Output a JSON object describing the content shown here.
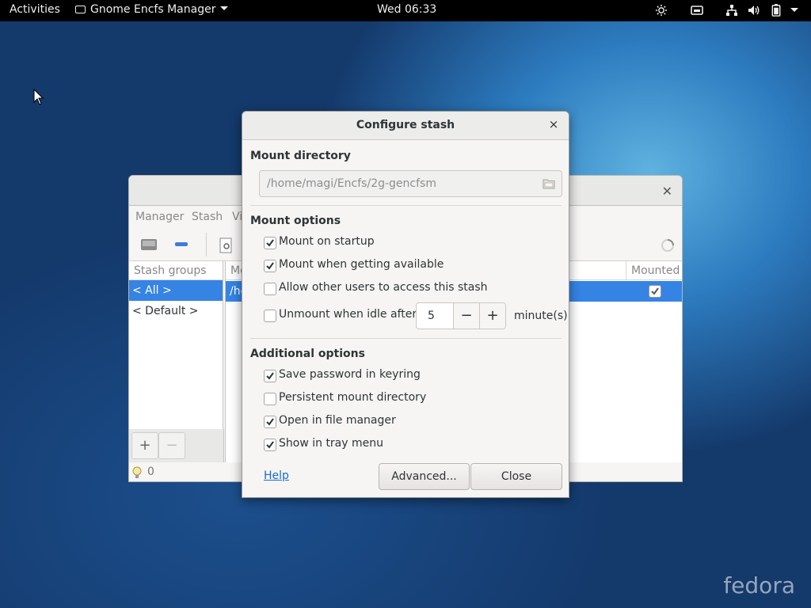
{
  "topbar": {
    "activities": "Activities",
    "app_name": "Gnome Encfs Manager",
    "clock": "Wed 06:33"
  },
  "main_window": {
    "menus": [
      "Manager",
      "Stash",
      "Vi"
    ],
    "sidebar_header": "Stash groups",
    "sidebar_items": [
      "< All >",
      "< Default >"
    ],
    "list_header_path": "Mo",
    "list_header_mounted": "Mounted",
    "list_row_path": "/ho",
    "list_row_mounted": true,
    "add_group_label": "+",
    "remove_group_label": "−",
    "status_count": "0"
  },
  "dialog": {
    "title": "Configure stash",
    "close_glyph": "×",
    "mount_directory": {
      "title": "Mount directory",
      "value": "/home/magi/Encfs/2g-gencfsm"
    },
    "mount_options": {
      "title": "Mount options",
      "items": [
        {
          "label": "Mount on startup",
          "checked": true
        },
        {
          "label": "Mount when getting available",
          "checked": true
        },
        {
          "label": "Allow other users to access this stash",
          "checked": false
        },
        {
          "label": "Unmount when idle after",
          "checked": false
        }
      ],
      "idle_minutes": "5",
      "minus_glyph": "−",
      "plus_glyph": "+",
      "minutes_unit": "minute(s)"
    },
    "additional_options": {
      "title": "Additional options",
      "items": [
        {
          "label": "Save password in keyring",
          "checked": true
        },
        {
          "label": "Persistent mount directory",
          "checked": false
        },
        {
          "label": "Open in file manager",
          "checked": true
        },
        {
          "label": "Show in tray menu",
          "checked": true
        }
      ]
    },
    "help_label": "Help",
    "advanced_label": "Advanced...",
    "close_label": "Close"
  },
  "desktop": {
    "watermark": "fedora"
  },
  "colors": {
    "accent": "#3584e4",
    "link": "#1b6acb",
    "topbar": "#000000"
  },
  "icons": [
    "pointer-icon",
    "drive-icon",
    "brightness-icon",
    "network-icon",
    "volume-icon",
    "battery-icon",
    "folder-icon",
    "spinner-icon",
    "lightbulb-icon"
  ]
}
